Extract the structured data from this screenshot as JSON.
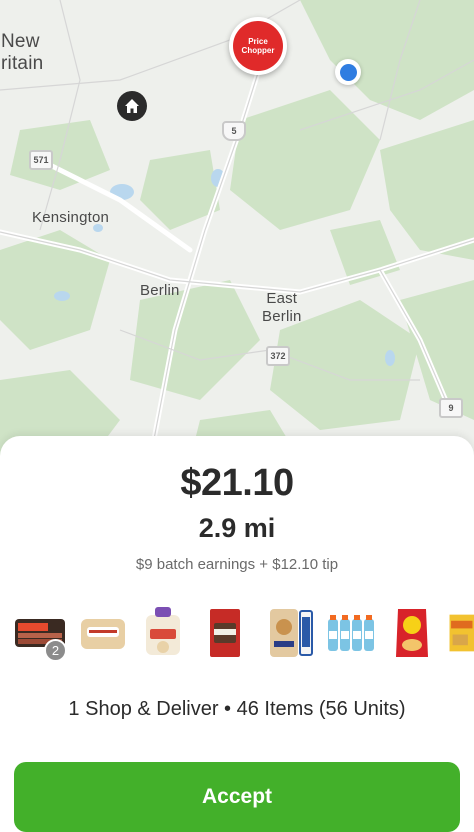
{
  "map": {
    "labels": {
      "new_britain": "New\nritain",
      "kensington": "Kensington",
      "berlin": "Berlin",
      "east_berlin": "East\nBerlin"
    },
    "route_shields": [
      "571",
      "5",
      "372",
      "9"
    ],
    "store_logo_text": "Price Chopper"
  },
  "offer": {
    "price": "$21.10",
    "distance": "2.9 mi",
    "earnings": "$9 batch earnings + $12.10 tip",
    "first_item_quantity": "2",
    "summary": "1 Shop & Deliver • 46 Items (56 Units)",
    "accept_label": "Accept"
  },
  "colors": {
    "accept": "#43b02a",
    "store_pin": "#e02a2a",
    "location_dot": "#2f7de1"
  },
  "items": [
    "bacon-package",
    "bread-rolls-bag",
    "wraps-bag",
    "snack-box",
    "bagels-bag",
    "everything-seasoning",
    "sports-drink-pack",
    "chips-bag",
    "cracker-box"
  ]
}
